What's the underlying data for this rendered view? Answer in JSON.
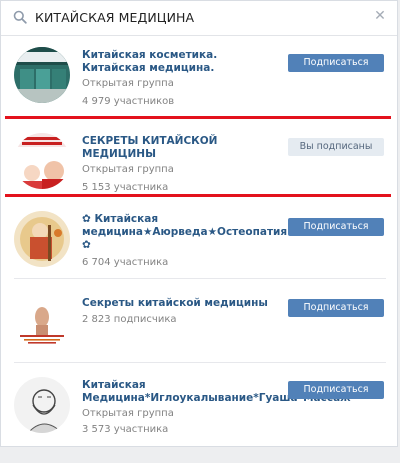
{
  "search": {
    "query": "КИТАЙСКАЯ МЕДИЦИНА",
    "icon": "search-icon",
    "clear_icon": "close-icon"
  },
  "results": [
    {
      "title": "Китайская косметика. Китайская медицина.",
      "type": "Открытая группа",
      "members": "4 979 участников",
      "button": "Подписаться"
    },
    {
      "title": "СЕКРЕТЫ КИТАЙСКОЙ МЕДИЦИНЫ",
      "type": "Открытая группа",
      "members": "5 153 участника",
      "button": "Вы подписаны"
    },
    {
      "title": "✿ Китайская медицина★Аюрведа★Остеопатия ✿",
      "members": "6 704 участника",
      "button": "Подписаться"
    },
    {
      "title": "Секреты китайской медицины",
      "members": "2 823 подписчика",
      "button": "Подписаться"
    },
    {
      "title": "Китайская Медицина*Иглоукалывание*Гуаша*Массаж",
      "type": "Открытая группа",
      "members": "3 573 участника",
      "button": "Подписаться"
    }
  ],
  "colors": {
    "accent": "#5181b8",
    "link": "#2a5885",
    "highlight": "#e3121c"
  }
}
